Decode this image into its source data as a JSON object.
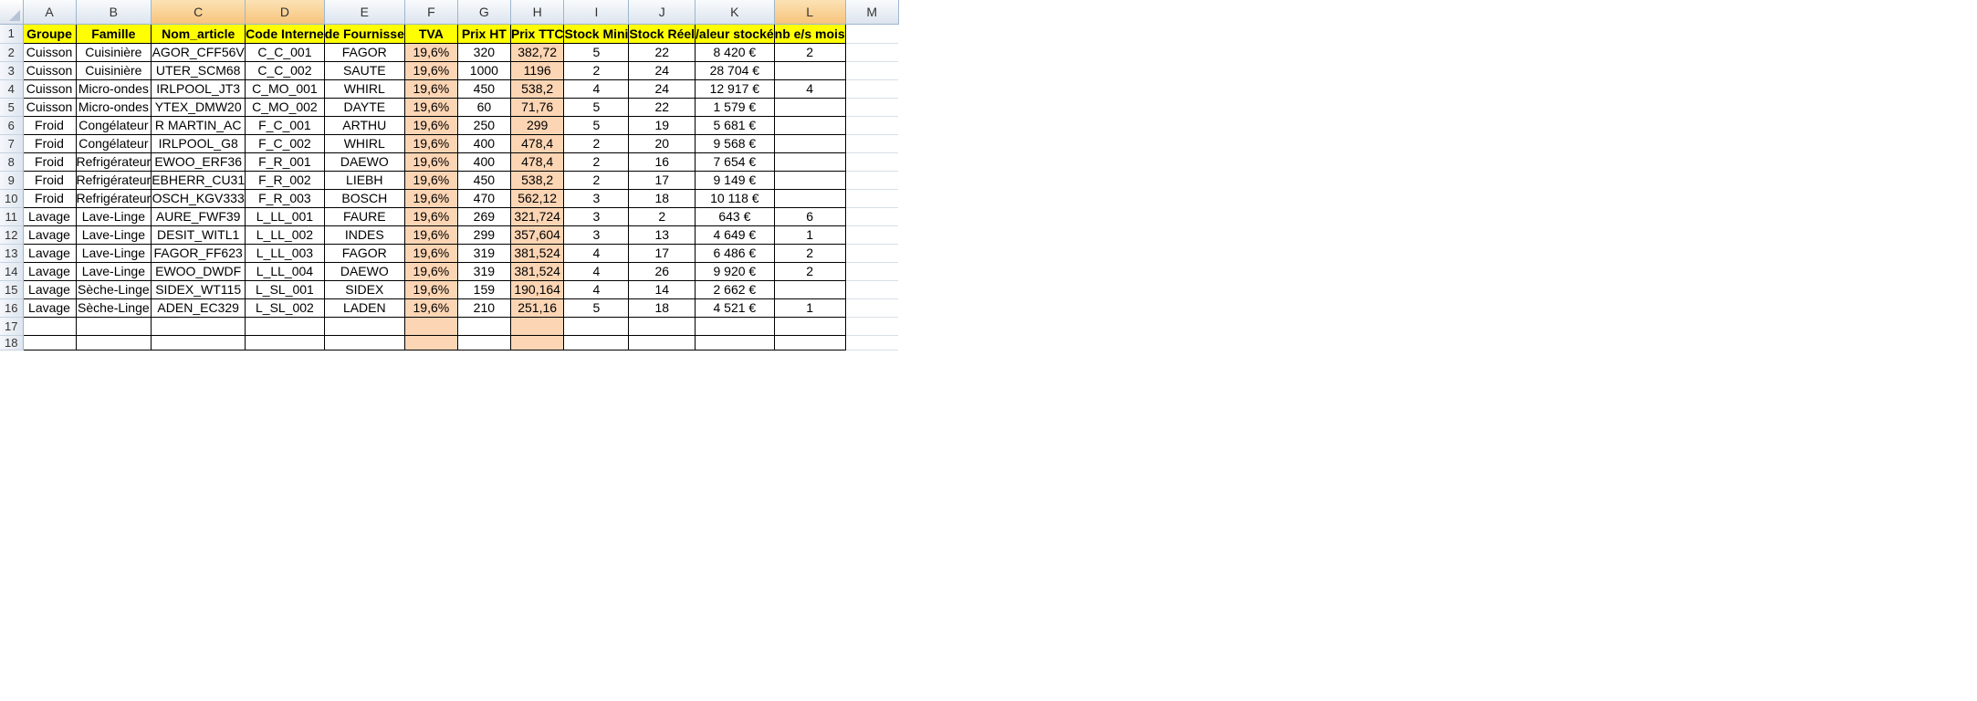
{
  "columns": [
    "A",
    "B",
    "C",
    "D",
    "E",
    "F",
    "G",
    "H",
    "I",
    "J",
    "K",
    "L",
    "M"
  ],
  "selected_columns": [
    "C",
    "D",
    "L"
  ],
  "row_numbers": [
    "1",
    "2",
    "3",
    "4",
    "5",
    "6",
    "7",
    "8",
    "9",
    "10",
    "11",
    "12",
    "13",
    "14",
    "15",
    "16",
    "17",
    "18"
  ],
  "headers": [
    "Groupe",
    "Famille",
    "Nom_article",
    "Code Interne",
    "de Fournisse",
    "TVA",
    "Prix HT",
    "Prix TTC",
    "Stock Mini",
    "Stock Réel",
    "/aleur stocké",
    "nb e/s mois"
  ],
  "rows": [
    [
      "Cuisson",
      "Cuisinière",
      "AGOR_CFF56V",
      "C_C_001",
      "FAGOR",
      "19,6%",
      "320",
      "382,72",
      "5",
      "22",
      "8 420 €",
      "2"
    ],
    [
      "Cuisson",
      "Cuisinière",
      "UTER_SCM68",
      "C_C_002",
      "SAUTE",
      "19,6%",
      "1000",
      "1196",
      "2",
      "24",
      "28 704 €",
      ""
    ],
    [
      "Cuisson",
      "Micro-ondes",
      "IRLPOOL_JT3",
      "C_MO_001",
      "WHIRL",
      "19,6%",
      "450",
      "538,2",
      "4",
      "24",
      "12 917 €",
      "4"
    ],
    [
      "Cuisson",
      "Micro-ondes",
      "YTEX_DMW20",
      "C_MO_002",
      "DAYTE",
      "19,6%",
      "60",
      "71,76",
      "5",
      "22",
      "1 579 €",
      ""
    ],
    [
      "Froid",
      "Congélateur",
      "R MARTIN_AC",
      "F_C_001",
      "ARTHU",
      "19,6%",
      "250",
      "299",
      "5",
      "19",
      "5 681 €",
      ""
    ],
    [
      "Froid",
      "Congélateur",
      "IRLPOOL_G8",
      "F_C_002",
      "WHIRL",
      "19,6%",
      "400",
      "478,4",
      "2",
      "20",
      "9 568 €",
      ""
    ],
    [
      "Froid",
      "Refrigérateur",
      "EWOO_ERF36",
      "F_R_001",
      "DAEWO",
      "19,6%",
      "400",
      "478,4",
      "2",
      "16",
      "7 654 €",
      ""
    ],
    [
      "Froid",
      "Refrigérateur",
      "EBHERR_CU31",
      "F_R_002",
      "LIEBH",
      "19,6%",
      "450",
      "538,2",
      "2",
      "17",
      "9 149 €",
      ""
    ],
    [
      "Froid",
      "Refrigérateur",
      "OSCH_KGV333",
      "F_R_003",
      "BOSCH",
      "19,6%",
      "470",
      "562,12",
      "3",
      "18",
      "10 118 €",
      ""
    ],
    [
      "Lavage",
      "Lave-Linge",
      "AURE_FWF39",
      "L_LL_001",
      "FAURE",
      "19,6%",
      "269",
      "321,724",
      "3",
      "2",
      "643 €",
      "6"
    ],
    [
      "Lavage",
      "Lave-Linge",
      "DESIT_WITL1",
      "L_LL_002",
      "INDES",
      "19,6%",
      "299",
      "357,604",
      "3",
      "13",
      "4 649 €",
      "1"
    ],
    [
      "Lavage",
      "Lave-Linge",
      "FAGOR_FF623",
      "L_LL_003",
      "FAGOR",
      "19,6%",
      "319",
      "381,524",
      "4",
      "17",
      "6 486 €",
      "2"
    ],
    [
      "Lavage",
      "Lave-Linge",
      "EWOO_DWDF",
      "L_LL_004",
      "DAEWO",
      "19,6%",
      "319",
      "381,524",
      "4",
      "26",
      "9 920 €",
      "2"
    ],
    [
      "Lavage",
      "Sèche-Linge",
      "SIDEX_WT115",
      "L_SL_001",
      "SIDEX",
      "19,6%",
      "159",
      "190,164",
      "4",
      "14",
      "2 662 €",
      ""
    ],
    [
      "Lavage",
      "Sèche-Linge",
      "ADEN_EC329",
      "L_SL_002",
      "LADEN",
      "19,6%",
      "210",
      "251,16",
      "5",
      "18",
      "4 521 €",
      "1"
    ]
  ],
  "colors": {
    "header_fill": "#ffff00",
    "tax_column_fill": "#fcd5b4",
    "selected_column_header": "#f7c47c",
    "header_chrome": "#dce4ee"
  }
}
